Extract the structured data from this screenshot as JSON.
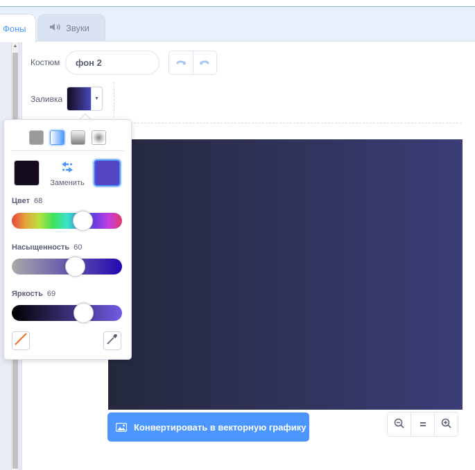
{
  "tabs": {
    "backdrops_label": "Фоны",
    "sounds_label": "Звуки"
  },
  "costume": {
    "label": "Костюм",
    "name_value": "фон 2"
  },
  "fill": {
    "label": "Заливка",
    "gradient_start": "#140b1f",
    "gradient_end": "#4a46b8"
  },
  "popover": {
    "gradient_types": [
      "solid",
      "horizontal",
      "vertical",
      "radial"
    ],
    "selected_gradient_type": "horizontal",
    "color_a": "#140b1f",
    "color_b": "#5445c4",
    "swap_label": "Заменить",
    "hue": {
      "label": "Цвет",
      "value": "68"
    },
    "saturation": {
      "label": "Насыщенность",
      "value": "60"
    },
    "brightness": {
      "label": "Яркость",
      "value": "69"
    }
  },
  "canvas": {
    "gradient_start": "#24283c",
    "gradient_end": "#3b3d77"
  },
  "convert_button": {
    "label": "Конвертировать в векторную графику"
  },
  "zoom": {
    "out_icon": "zoom-out-icon",
    "reset_icon": "zoom-reset-icon",
    "in_icon": "zoom-in-icon"
  },
  "colors": {
    "accent": "#4c97ff",
    "text": "#575e75"
  }
}
